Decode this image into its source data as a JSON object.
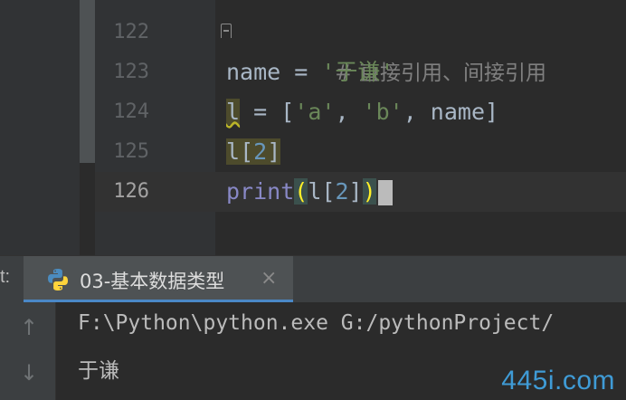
{
  "editor": {
    "lines": [
      {
        "number": "122",
        "tokens": [
          "# ",
          "直接引用、间接引用"
        ]
      },
      {
        "number": "123",
        "tokens": [
          "name",
          " = ",
          "'于谦'"
        ]
      },
      {
        "number": "124",
        "tokens": [
          "l",
          " = [",
          "'a'",
          ", ",
          "'b'",
          ", name]"
        ]
      },
      {
        "number": "125",
        "tokens": [
          "l",
          "[",
          "2",
          "]"
        ]
      },
      {
        "number": "126",
        "tokens": [
          "print",
          "(",
          "l[",
          "2",
          "]",
          ")"
        ]
      }
    ],
    "current_line": "126"
  },
  "tool_window": {
    "label": "t:",
    "run_tab": {
      "label": "03-基本数据类型",
      "close": "×"
    }
  },
  "console": {
    "command": "F:\\Python\\python.exe G:/pythonProject/",
    "output": "于谦",
    "up_arrow": "↑",
    "down_arrow": "↓"
  },
  "watermark": "445i.com",
  "colors": {
    "editor_bg": "#2b2b2b",
    "gutter_bg": "#313335",
    "string": "#6a8759",
    "number": "#6897bb",
    "builtin": "#8888c6",
    "paren_match": "#ffef28",
    "tab_underline": "#4a88c7",
    "watermark": "#3f9bd6"
  }
}
